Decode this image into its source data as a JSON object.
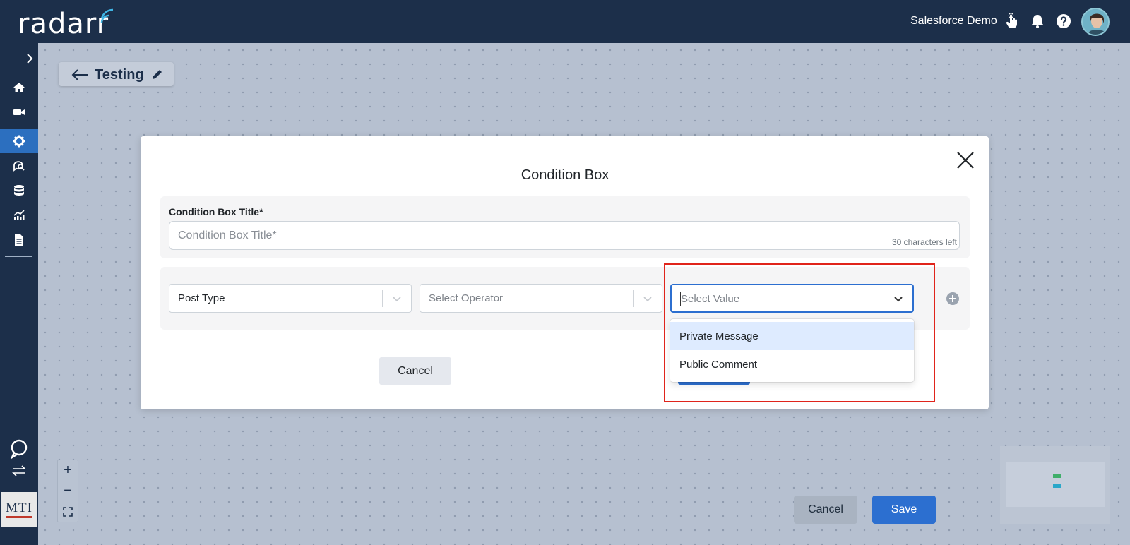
{
  "header": {
    "logo_text": "radarr",
    "org_name": "Salesforce Demo"
  },
  "sidebar": {
    "items": [
      {
        "icon": "home-icon"
      },
      {
        "icon": "video-icon"
      },
      {
        "icon": "gear-icon",
        "active": true
      },
      {
        "icon": "search-chat-icon"
      },
      {
        "icon": "database-icon"
      },
      {
        "icon": "analytics-icon"
      },
      {
        "icon": "document-icon"
      }
    ],
    "mti_logo": "MTI"
  },
  "canvas": {
    "flow_title": "Testing",
    "zoom_in": "+",
    "zoom_out": "−",
    "cancel_label": "Cancel",
    "save_label": "Save"
  },
  "modal": {
    "title": "Condition Box",
    "title_field": {
      "label": "Condition Box Title*",
      "placeholder": "Condition Box Title*",
      "value": "",
      "chars_left": "30 characters left"
    },
    "condition": {
      "field_value": "Post Type",
      "operator_placeholder": "Select Operator",
      "value_placeholder": "Select Value"
    },
    "dropdown_options": [
      "Private Message",
      "Public Comment"
    ],
    "cancel_label": "Cancel"
  },
  "colors": {
    "navy": "#1c2f4a",
    "primary": "#2c6fd0",
    "highlight_red": "#e0241b",
    "option_hover": "#deebff"
  }
}
